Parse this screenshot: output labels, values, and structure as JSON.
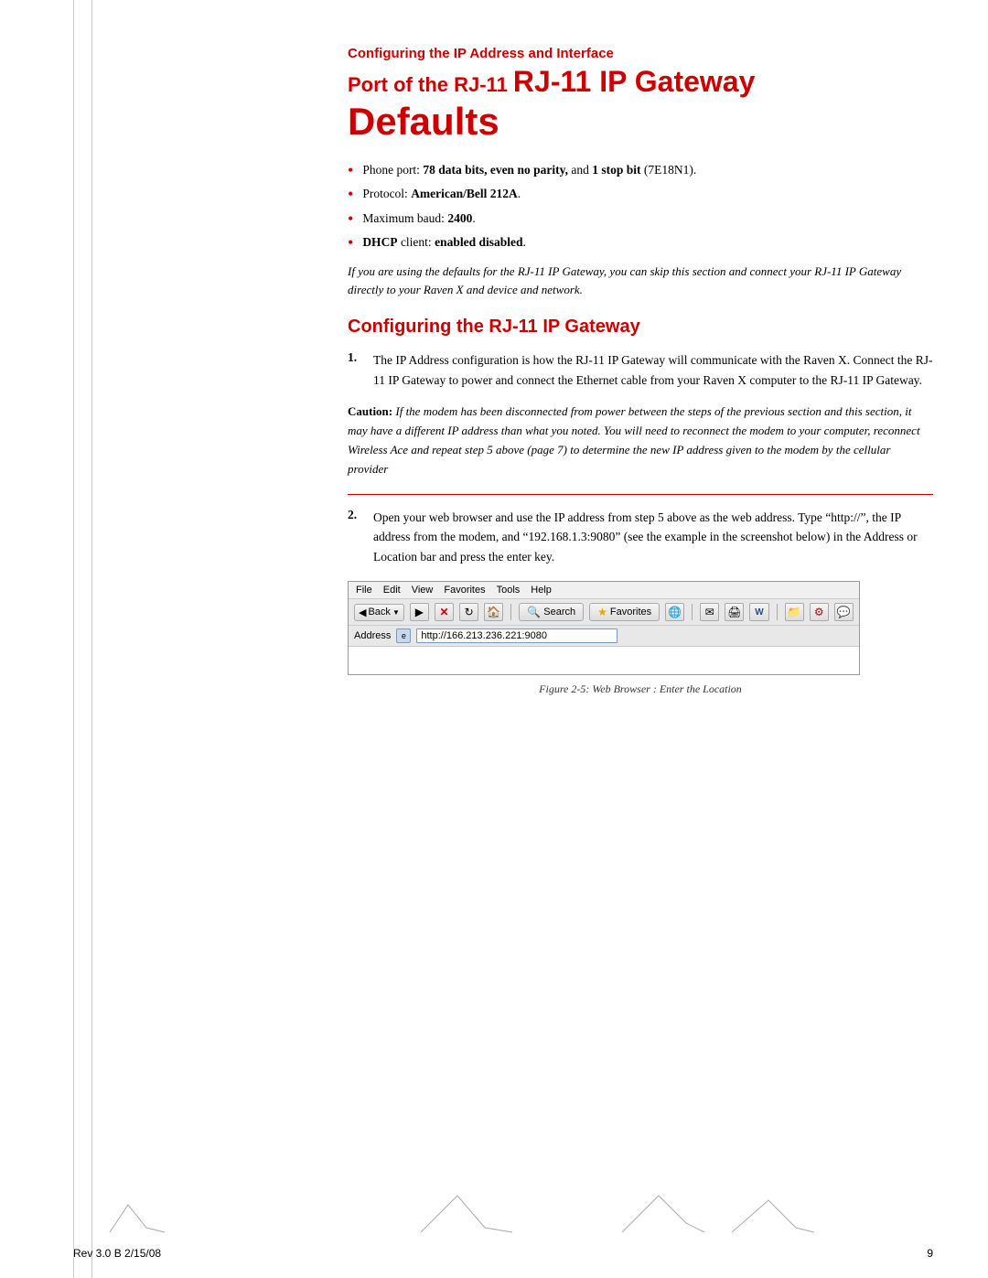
{
  "page": {
    "title_line1": "Configuring the IP Address and Interface",
    "title_line2": "Port of the RJ-11",
    "title_line3": "RJ-11 IP Gateway",
    "title_line4": "Defaults",
    "bullets": [
      {
        "label": "Phone port: ",
        "bold1": "78 data bits, even no parity,",
        "text1": " and ",
        "bold2": "1 stop bit",
        "text2": " (7E18N1)."
      },
      {
        "label": "Protocol: ",
        "bold1": "American/Bell 212A",
        "text1": ".",
        "bold2": "",
        "text2": ""
      },
      {
        "label": "Maximum baud: ",
        "bold1": "2400",
        "text1": ".",
        "bold2": "",
        "text2": ""
      },
      {
        "label": "",
        "bold1": "DHCP",
        "text1": " client: ",
        "bold2": "enabled disabled",
        "text2": "."
      }
    ],
    "italic_note": "If you are using the defaults for the  RJ-11 IP Gateway, you can skip this section and connect your RJ-11 IP Gateway directly to your Raven X and device and network.",
    "section_heading": "Configuring the RJ-11 IP Gateway",
    "step1_number": "1.",
    "step1_text": "The IP Address configuration is how the RJ-11 IP Gateway will communicate with the Raven X. Connect the  RJ-11 IP Gateway to power and connect the Ethernet cable from your Raven X computer to the  RJ-11 IP Gateway.",
    "caution_label": "Caution:",
    "caution_text": "  If the modem has been disconnected from power between the steps of the previous section and this section, it may have a different IP address than what you noted. You will need to reconnect the modem to your computer, reconnect Wireless Ace and repeat step 5 above (page 7) to determine the new IP address given to the modem by the cellular provider",
    "step2_number": "2.",
    "step2_text": "Open your web browser and use the IP address from step 5 above as the web address. Type “http://”, the IP address from the modem, and “192.168.1.3:9080” (see the example in the screenshot below) in the Address or Location bar and press the enter key.",
    "browser": {
      "menu_items": [
        "File",
        "Edit",
        "View",
        "Favorites",
        "Tools",
        "Help"
      ],
      "back_label": "Back",
      "search_label": "Search",
      "favorites_label": "Favorites",
      "address_label": "Address",
      "address_url": "http://166.213.236.221:9080"
    },
    "figure_caption": "Figure 2-5:  Web Browser : Enter the Location",
    "footer_left": "Rev 3.0 B  2/15/08",
    "footer_right": "9"
  }
}
